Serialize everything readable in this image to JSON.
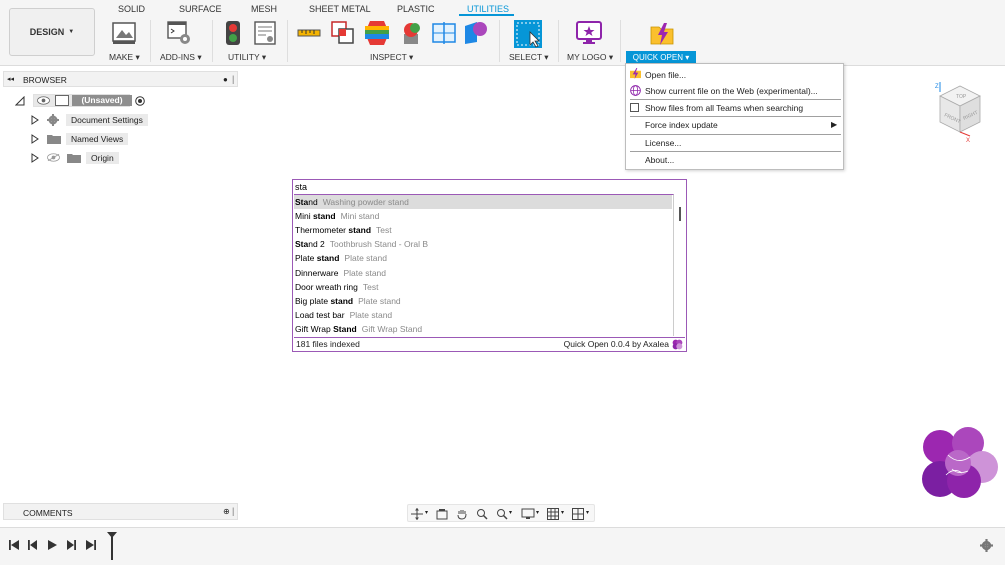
{
  "toolbar": {
    "design_label": "DESIGN",
    "tabs": [
      {
        "label": "SOLID",
        "active": false
      },
      {
        "label": "SURFACE",
        "active": false
      },
      {
        "label": "MESH",
        "active": false
      },
      {
        "label": "SHEET METAL",
        "active": false
      },
      {
        "label": "PLASTIC",
        "active": false
      },
      {
        "label": "UTILITIES",
        "active": true
      }
    ],
    "groups": {
      "make": "MAKE",
      "addins": "ADD-INS",
      "utility": "UTILITY",
      "inspect": "INSPECT",
      "select": "SELECT",
      "mylogo": "MY LOGO",
      "quickopen": "QUICK OPEN"
    }
  },
  "quick_open_menu": {
    "items": {
      "open_file": "Open file...",
      "show_current": "Show current file on the Web (experimental)...",
      "show_all_teams": "Show files from all Teams when searching",
      "force_index": "Force index update",
      "license": "License...",
      "about": "About..."
    },
    "show_all_teams_checked": false
  },
  "browser": {
    "title": "BROWSER",
    "root": "(Unsaved)",
    "items": [
      "Document Settings",
      "Named Views",
      "Origin"
    ]
  },
  "search": {
    "query": "sta",
    "results": [
      {
        "hl": "Sta",
        "rest": "nd",
        "sub": "Washing powder stand"
      },
      {
        "pre": "Mini ",
        "hl": "stand",
        "rest": "",
        "sub": "Mini stand"
      },
      {
        "pre": "Thermometer ",
        "hl": "stand",
        "rest": "",
        "sub": "Test"
      },
      {
        "hl": "Sta",
        "rest": "nd 2",
        "sub": "Toothbrush Stand - Oral B"
      },
      {
        "pre": "Plate ",
        "hl": "stand",
        "rest": "",
        "sub": "Plate stand"
      },
      {
        "pre": "Dinnerware",
        "hl": "",
        "rest": "",
        "sub": "Plate stand"
      },
      {
        "pre": "Door wreath ring",
        "hl": "",
        "rest": "",
        "sub": "Test"
      },
      {
        "pre": "Big plate ",
        "hl": "stand",
        "rest": "",
        "sub": "Plate stand"
      },
      {
        "pre": "Load test bar",
        "hl": "",
        "rest": "",
        "sub": "Plate stand"
      },
      {
        "pre": "Gift Wrap ",
        "hl": "Stand",
        "rest": "",
        "sub": "Gift Wrap Stand"
      }
    ],
    "footer_left": "181 files indexed",
    "footer_right": "Quick Open 0.0.4 by Axalea"
  },
  "comments": {
    "title": "COMMENTS"
  },
  "viewcube": {
    "top": "TOP",
    "front": "FRONT",
    "right": "RIGHT",
    "z": "Z",
    "x": "X"
  },
  "colors": {
    "accent": "#0696d7",
    "purple": "#9b59b6",
    "lightning": "#f5b400"
  }
}
